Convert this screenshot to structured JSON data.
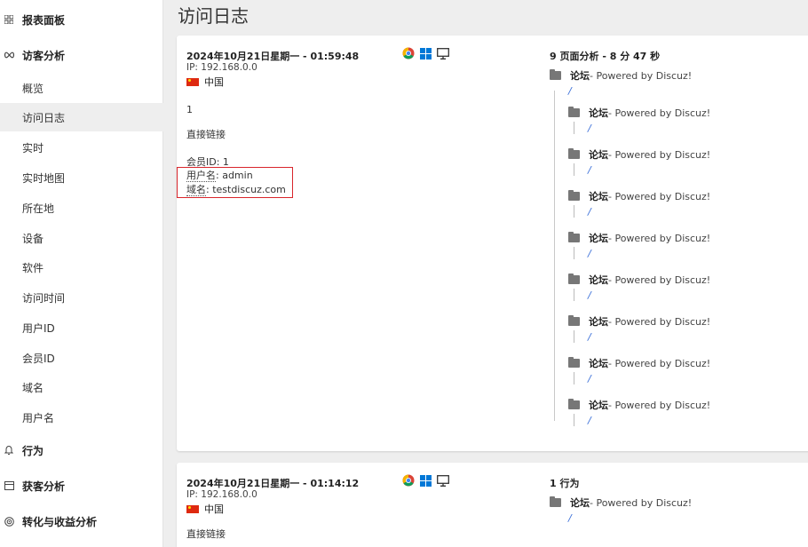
{
  "sidebar": {
    "groups": [
      {
        "label": "报表面板",
        "icon": "grid-icon"
      },
      {
        "label": "访客分析",
        "icon": "infinity-icon"
      },
      {
        "label": "行为",
        "icon": "bell-icon"
      },
      {
        "label": "获客分析",
        "icon": "box-icon"
      },
      {
        "label": "转化与收益分析",
        "icon": "target-icon"
      }
    ],
    "items": [
      "概览",
      "访问日志",
      "实时",
      "实时地图",
      "所在地",
      "设备",
      "软件",
      "访问时间",
      "用户ID",
      "会员ID",
      "域名",
      "用户名"
    ],
    "active_item": "访问日志"
  },
  "page_title": "访问日志",
  "visits": [
    {
      "datetime": "2024年10月21日星期一 - 01:59:48",
      "ip": "IP: 192.168.0.0",
      "country": "中国",
      "visit_number": "1",
      "referrer": "直接链接",
      "member_id": "会员ID: 1",
      "username_label": "用户名",
      "username_value": ": admin",
      "domain_label": "域名",
      "domain_value": ": testdiscuz.com",
      "summary": "9 页面分析 - 8 分 47 秒",
      "actions": [
        {
          "title": "论坛",
          "suffix": " - Powered by Discuz!",
          "url": "/"
        },
        {
          "title": "论坛",
          "suffix": " - Powered by Discuz!",
          "url": "/"
        },
        {
          "title": "论坛",
          "suffix": " - Powered by Discuz!",
          "url": "/"
        },
        {
          "title": "论坛",
          "suffix": " - Powered by Discuz!",
          "url": "/"
        },
        {
          "title": "论坛",
          "suffix": " - Powered by Discuz!",
          "url": "/"
        },
        {
          "title": "论坛",
          "suffix": " - Powered by Discuz!",
          "url": "/"
        },
        {
          "title": "论坛",
          "suffix": " - Powered by Discuz!",
          "url": "/"
        },
        {
          "title": "论坛",
          "suffix": " - Powered by Discuz!",
          "url": "/"
        },
        {
          "title": "论坛",
          "suffix": " - Powered by Discuz!",
          "url": "/"
        }
      ]
    },
    {
      "datetime": "2024年10月21日星期一 - 01:14:12",
      "ip": "IP: 192.168.0.0",
      "country": "中国",
      "referrer": "直接链接",
      "summary": "1 行为",
      "actions": [
        {
          "title": "论坛",
          "suffix": " - Powered by Discuz!",
          "url": "/"
        }
      ]
    }
  ],
  "colors": {
    "highlight": "#d9262c",
    "link": "#3a6fd8",
    "flag_red": "#de2910",
    "windows_blue": "#0078d7"
  },
  "icons": {
    "browser": "chrome-icon",
    "os": "windows-icon",
    "device": "desktop-icon"
  }
}
